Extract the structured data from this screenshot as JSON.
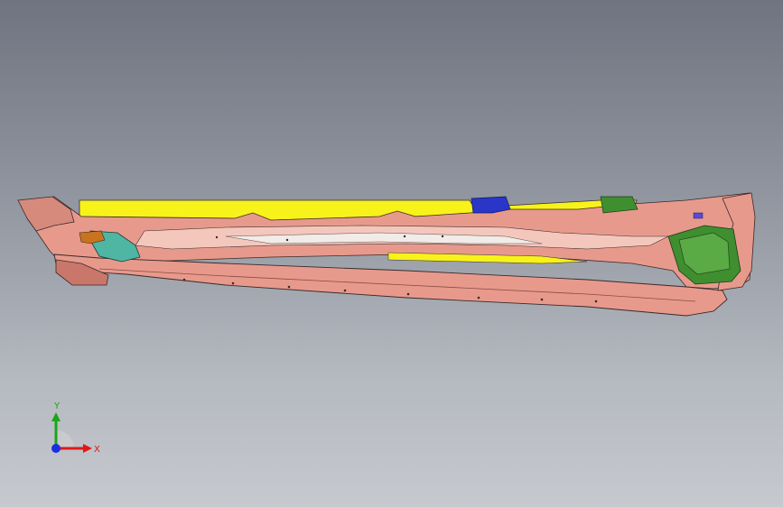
{
  "viewport": {
    "background_top": "#6f7480",
    "background_bottom": "#c6c9ce"
  },
  "model": {
    "colors": {
      "body": "#e79a8c",
      "body_dark": "#c9776b",
      "rail_yellow": "#f7f21a",
      "bracket_green": "#3f8e2f",
      "bracket_teal": "#4fb6a3",
      "bracket_orange": "#c9731f",
      "bracket_blue": "#2a36c8",
      "edge": "#3a2a2a"
    }
  },
  "triad": {
    "x_label": "X",
    "y_label": "Y",
    "x_color": "#e01818",
    "y_color": "#1aa51a",
    "z_color": "#1a2ee0"
  }
}
